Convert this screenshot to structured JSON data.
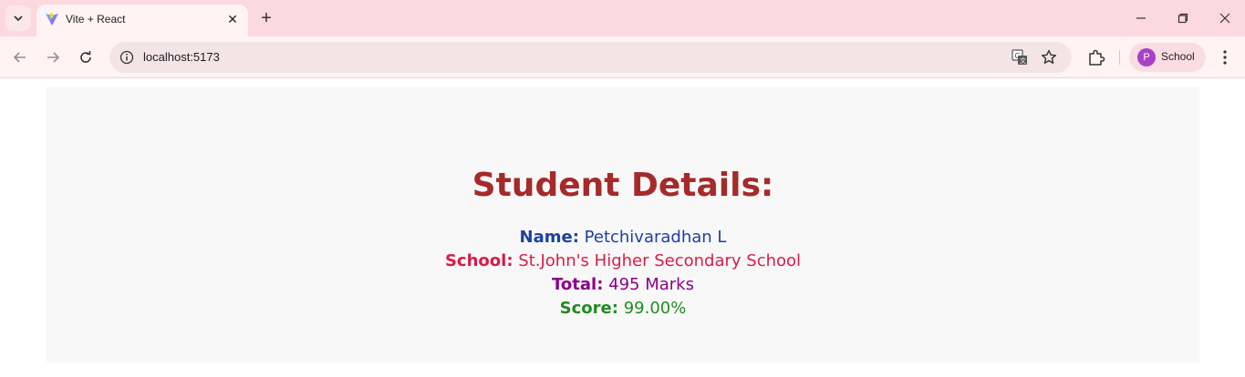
{
  "browser": {
    "tab": {
      "title": "Vite + React"
    },
    "address": {
      "url": "localhost:5173"
    },
    "profile": {
      "initial": "P",
      "name": "School"
    }
  },
  "page": {
    "heading": "Student Details:",
    "fields": {
      "name": {
        "label": "Name:",
        "value": "Petchivaradhan L"
      },
      "school": {
        "label": "School:",
        "value": "St.John's Higher Secondary School"
      },
      "total": {
        "label": "Total:",
        "value": "495 Marks"
      },
      "score": {
        "label": "Score:",
        "value": "99.00%"
      }
    }
  },
  "colors": {
    "heading": "#a52a2a",
    "name": "#1f3fa0",
    "school": "#d81b4a",
    "total": "#8b008b",
    "score": "#228b22",
    "tabstrip": "#fcd9df"
  }
}
